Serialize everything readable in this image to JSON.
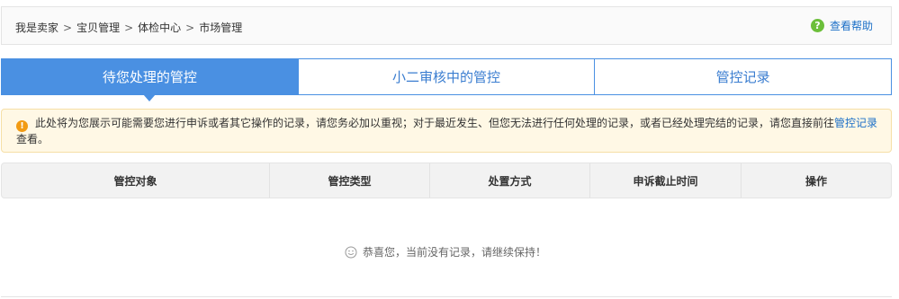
{
  "breadcrumb": {
    "items": [
      "我是卖家",
      "宝贝管理",
      "体检中心",
      "市场管理"
    ],
    "separator": ">"
  },
  "help": {
    "label": "查看帮助",
    "icon": "question-icon"
  },
  "tabs": [
    {
      "label": "待您处理的管控",
      "active": true
    },
    {
      "label": "小二审核中的管控",
      "active": false
    },
    {
      "label": "管控记录",
      "active": false
    }
  ],
  "notice": {
    "icon": "info-icon",
    "text": "此处将为您展示可能需要您进行申诉或者其它操作的记录，请您务必加以重视；对于最近发生、但您无法进行任何处理的记录，或者已经处理完结的记录，请您直接前往",
    "link": "管控记录",
    "tail": "查看。"
  },
  "table": {
    "columns": [
      "管控对象",
      "管控类型",
      "处置方式",
      "申诉截止时间",
      "操作"
    ]
  },
  "empty": {
    "icon": "smile-icon",
    "text": "恭喜您，当前没有记录，请继续保持！"
  },
  "colors": {
    "accent": "#4a90e2",
    "link": "#1b6fc7",
    "notice_bg": "#fff8e5",
    "warning": "#f29b13",
    "help_green": "#6cbf3a"
  }
}
